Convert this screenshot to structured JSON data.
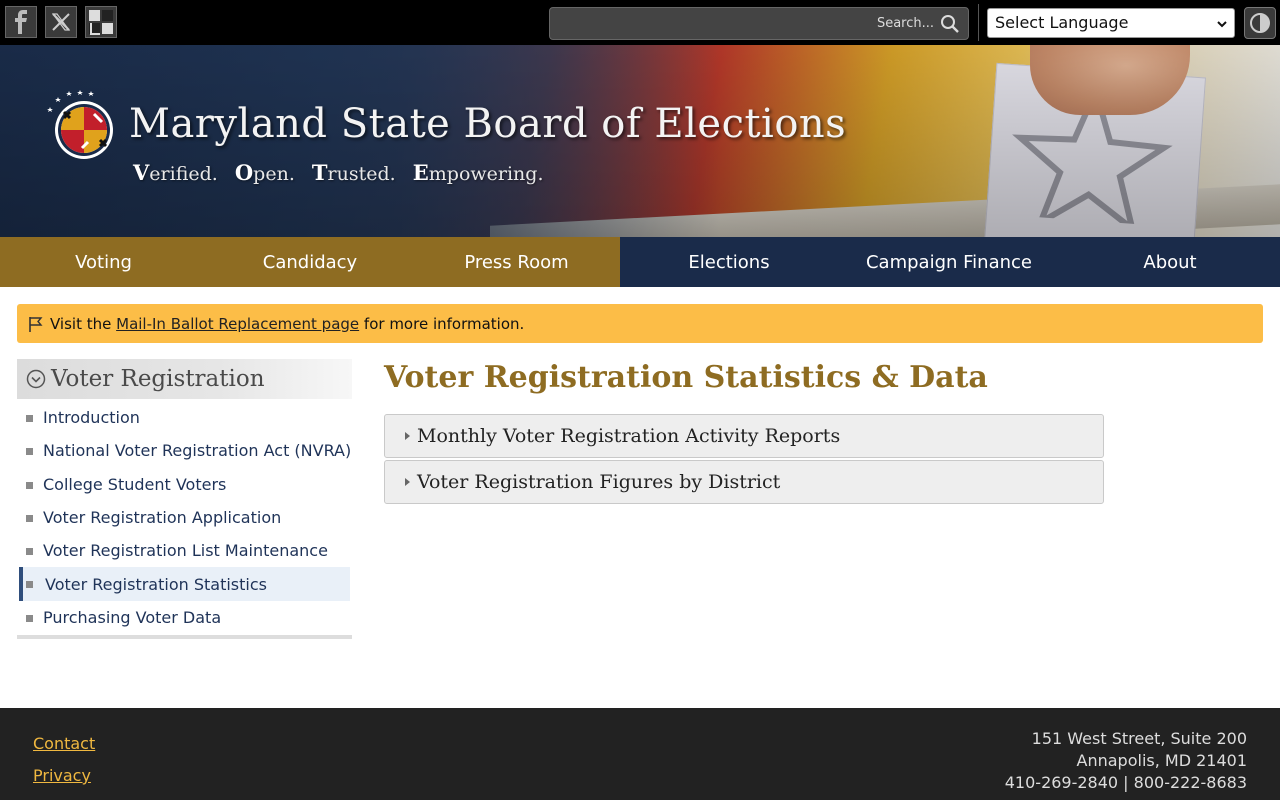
{
  "colors": {
    "gold": "#8e6c22",
    "navy": "#1a2b4a",
    "alert": "#fcbd47",
    "footer_link": "#f0b840"
  },
  "topbar": {
    "social": [
      {
        "icon": "facebook-icon"
      },
      {
        "icon": "x-icon"
      },
      {
        "icon": "flickr-icon"
      }
    ],
    "search_placeholder": "Search...",
    "language_selected": "Select Language",
    "contrast_icon": "contrast-icon"
  },
  "banner": {
    "title": "Maryland State Board of Elections",
    "tagline": [
      {
        "first": "V",
        "rest": "erified."
      },
      {
        "first": "O",
        "rest": "pen."
      },
      {
        "first": "T",
        "rest": "rusted."
      },
      {
        "first": "E",
        "rest": "mpowering."
      }
    ]
  },
  "nav": [
    {
      "label": "Voting"
    },
    {
      "label": "Candidacy"
    },
    {
      "label": "Press Room"
    },
    {
      "label": "Elections"
    },
    {
      "label": "Campaign Finance"
    },
    {
      "label": "About"
    }
  ],
  "alert": {
    "prefix": "Visit the ",
    "link": "Mail-In Ballot Replacement page",
    "suffix": " for more information."
  },
  "sidebar": {
    "title": "Voter Registration",
    "items": [
      {
        "label": "Introduction"
      },
      {
        "label": "National Voter Registration Act (NVRA)"
      },
      {
        "label": "College Student Voters"
      },
      {
        "label": "Voter Registration Application"
      },
      {
        "label": "Voter Registration List Maintenance"
      },
      {
        "label": "Voter Registration Statistics"
      },
      {
        "label": "Purchasing Voter Data"
      }
    ]
  },
  "main": {
    "title": "Voter Registration Statistics & Data",
    "accordions": [
      {
        "label": "Monthly Voter Registration Activity Reports"
      },
      {
        "label": "Voter Registration Figures by District"
      }
    ]
  },
  "footer": {
    "links": [
      {
        "label": "Contact"
      },
      {
        "label": "Privacy"
      }
    ],
    "address": [
      "151 West Street, Suite 200",
      "Annapolis, MD 21401",
      "410-269-2840 | 800-222-8683"
    ]
  }
}
